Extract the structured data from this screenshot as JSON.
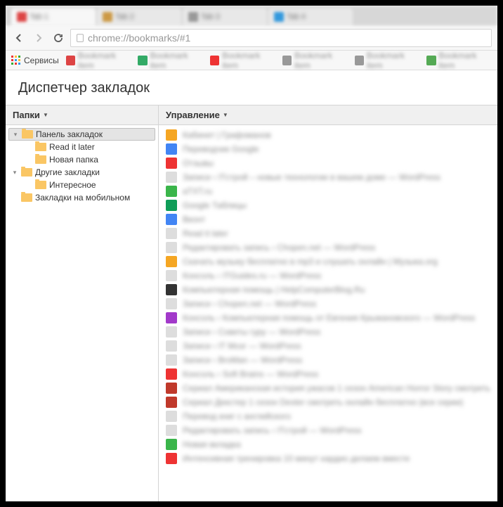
{
  "tabs": [
    {
      "favicon": "#d44",
      "label": "Tab 1"
    },
    {
      "favicon": "#c94",
      "label": "Tab 2"
    },
    {
      "favicon": "#999",
      "label": "Tab 3"
    },
    {
      "favicon": "#39d",
      "label": "Tab 4"
    }
  ],
  "url": "chrome://bookmarks/#1",
  "bookmarks_bar": {
    "apps_label": "Сервисы",
    "items": [
      {
        "favicon": "#d44",
        "label": "Bookmark item"
      },
      {
        "favicon": "#3a6",
        "label": "Bookmark item"
      },
      {
        "favicon": "#e33",
        "label": "Bookmark item"
      },
      {
        "favicon": "#999",
        "label": "Bookmark item"
      },
      {
        "favicon": "#999",
        "label": "Bookmark item"
      },
      {
        "favicon": "#5a5",
        "label": "Bookmark item"
      }
    ]
  },
  "page": {
    "title": "Диспетчер закладок",
    "folders_header": "Папки",
    "manage_header": "Управление"
  },
  "folders": [
    {
      "label": "Панель закладок",
      "level": 0,
      "expandable": true,
      "selected": true
    },
    {
      "label": "Read it later",
      "level": 1,
      "expandable": false,
      "selected": false
    },
    {
      "label": "Новая папка",
      "level": 1,
      "expandable": false,
      "selected": false
    },
    {
      "label": "Другие закладки",
      "level": 0,
      "expandable": true,
      "selected": false
    },
    {
      "label": "Интересное",
      "level": 1,
      "expandable": false,
      "selected": false
    },
    {
      "label": "Закладки на мобильном",
      "level": 0,
      "expandable": false,
      "selected": false
    }
  ],
  "bookmarks": [
    {
      "favicon": "#f5a623",
      "label": "Кабинет | Графоманов"
    },
    {
      "favicon": "#4285f4",
      "label": "Переводчик Google"
    },
    {
      "favicon": "#e33",
      "label": "Отзывы"
    },
    {
      "favicon": "#ddd",
      "label": "Записи ‹ ITстрой – новые технологии в вашем доме — WordPress"
    },
    {
      "favicon": "#3ab54a",
      "label": "aTXT.ru"
    },
    {
      "favicon": "#0f9d58",
      "label": "Google Таблицы"
    },
    {
      "favicon": "#4285f4",
      "label": "Вконт"
    },
    {
      "favicon": "#ddd",
      "label": "Read it later"
    },
    {
      "favicon": "#ddd",
      "label": "Редактировать запись ‹ Chopen.net — WordPress"
    },
    {
      "favicon": "#f5a623",
      "label": "Скачать музыку бесплатно в mp3 и слушать онлайн | Музыка.org"
    },
    {
      "favicon": "#ddd",
      "label": "Консоль ‹ ITGuides.ru — WordPress"
    },
    {
      "favicon": "#333",
      "label": "Компьютерная помощь | HelpComputerBlog.Ru"
    },
    {
      "favicon": "#ddd",
      "label": "Записи ‹ Chopen.net — WordPress"
    },
    {
      "favicon": "#a239ca",
      "label": "Консоль ‹ Компьютерная помощь от Евгения Крыжановского — WordPress"
    },
    {
      "favicon": "#ddd",
      "label": "Записи ‹ Советы гуру — WordPress"
    },
    {
      "favicon": "#ddd",
      "label": "Записи ‹ IT Мозг — WordPress"
    },
    {
      "favicon": "#ddd",
      "label": "Записи ‹ BroMan — WordPress"
    },
    {
      "favicon": "#e33",
      "label": "Консоль ‹ Soft Brains — WordPress"
    },
    {
      "favicon": "#c0392b",
      "label": "Сериал Американская история ужасов 1 сезон American Horror Story смотреть"
    },
    {
      "favicon": "#c0392b",
      "label": "Сериал Декстер 1 сезон Dexter смотреть онлайн бесплатно (все серии)"
    },
    {
      "favicon": "#ddd",
      "label": "Перевод книг с английского"
    },
    {
      "favicon": "#ddd",
      "label": "Редактировать запись ‹ ITстрой — WordPress"
    },
    {
      "favicon": "#3ab54a",
      "label": "Новая вкладка"
    },
    {
      "favicon": "#e33",
      "label": "Интенсивная тренировка 10 минут кардио делаем вместе"
    }
  ]
}
